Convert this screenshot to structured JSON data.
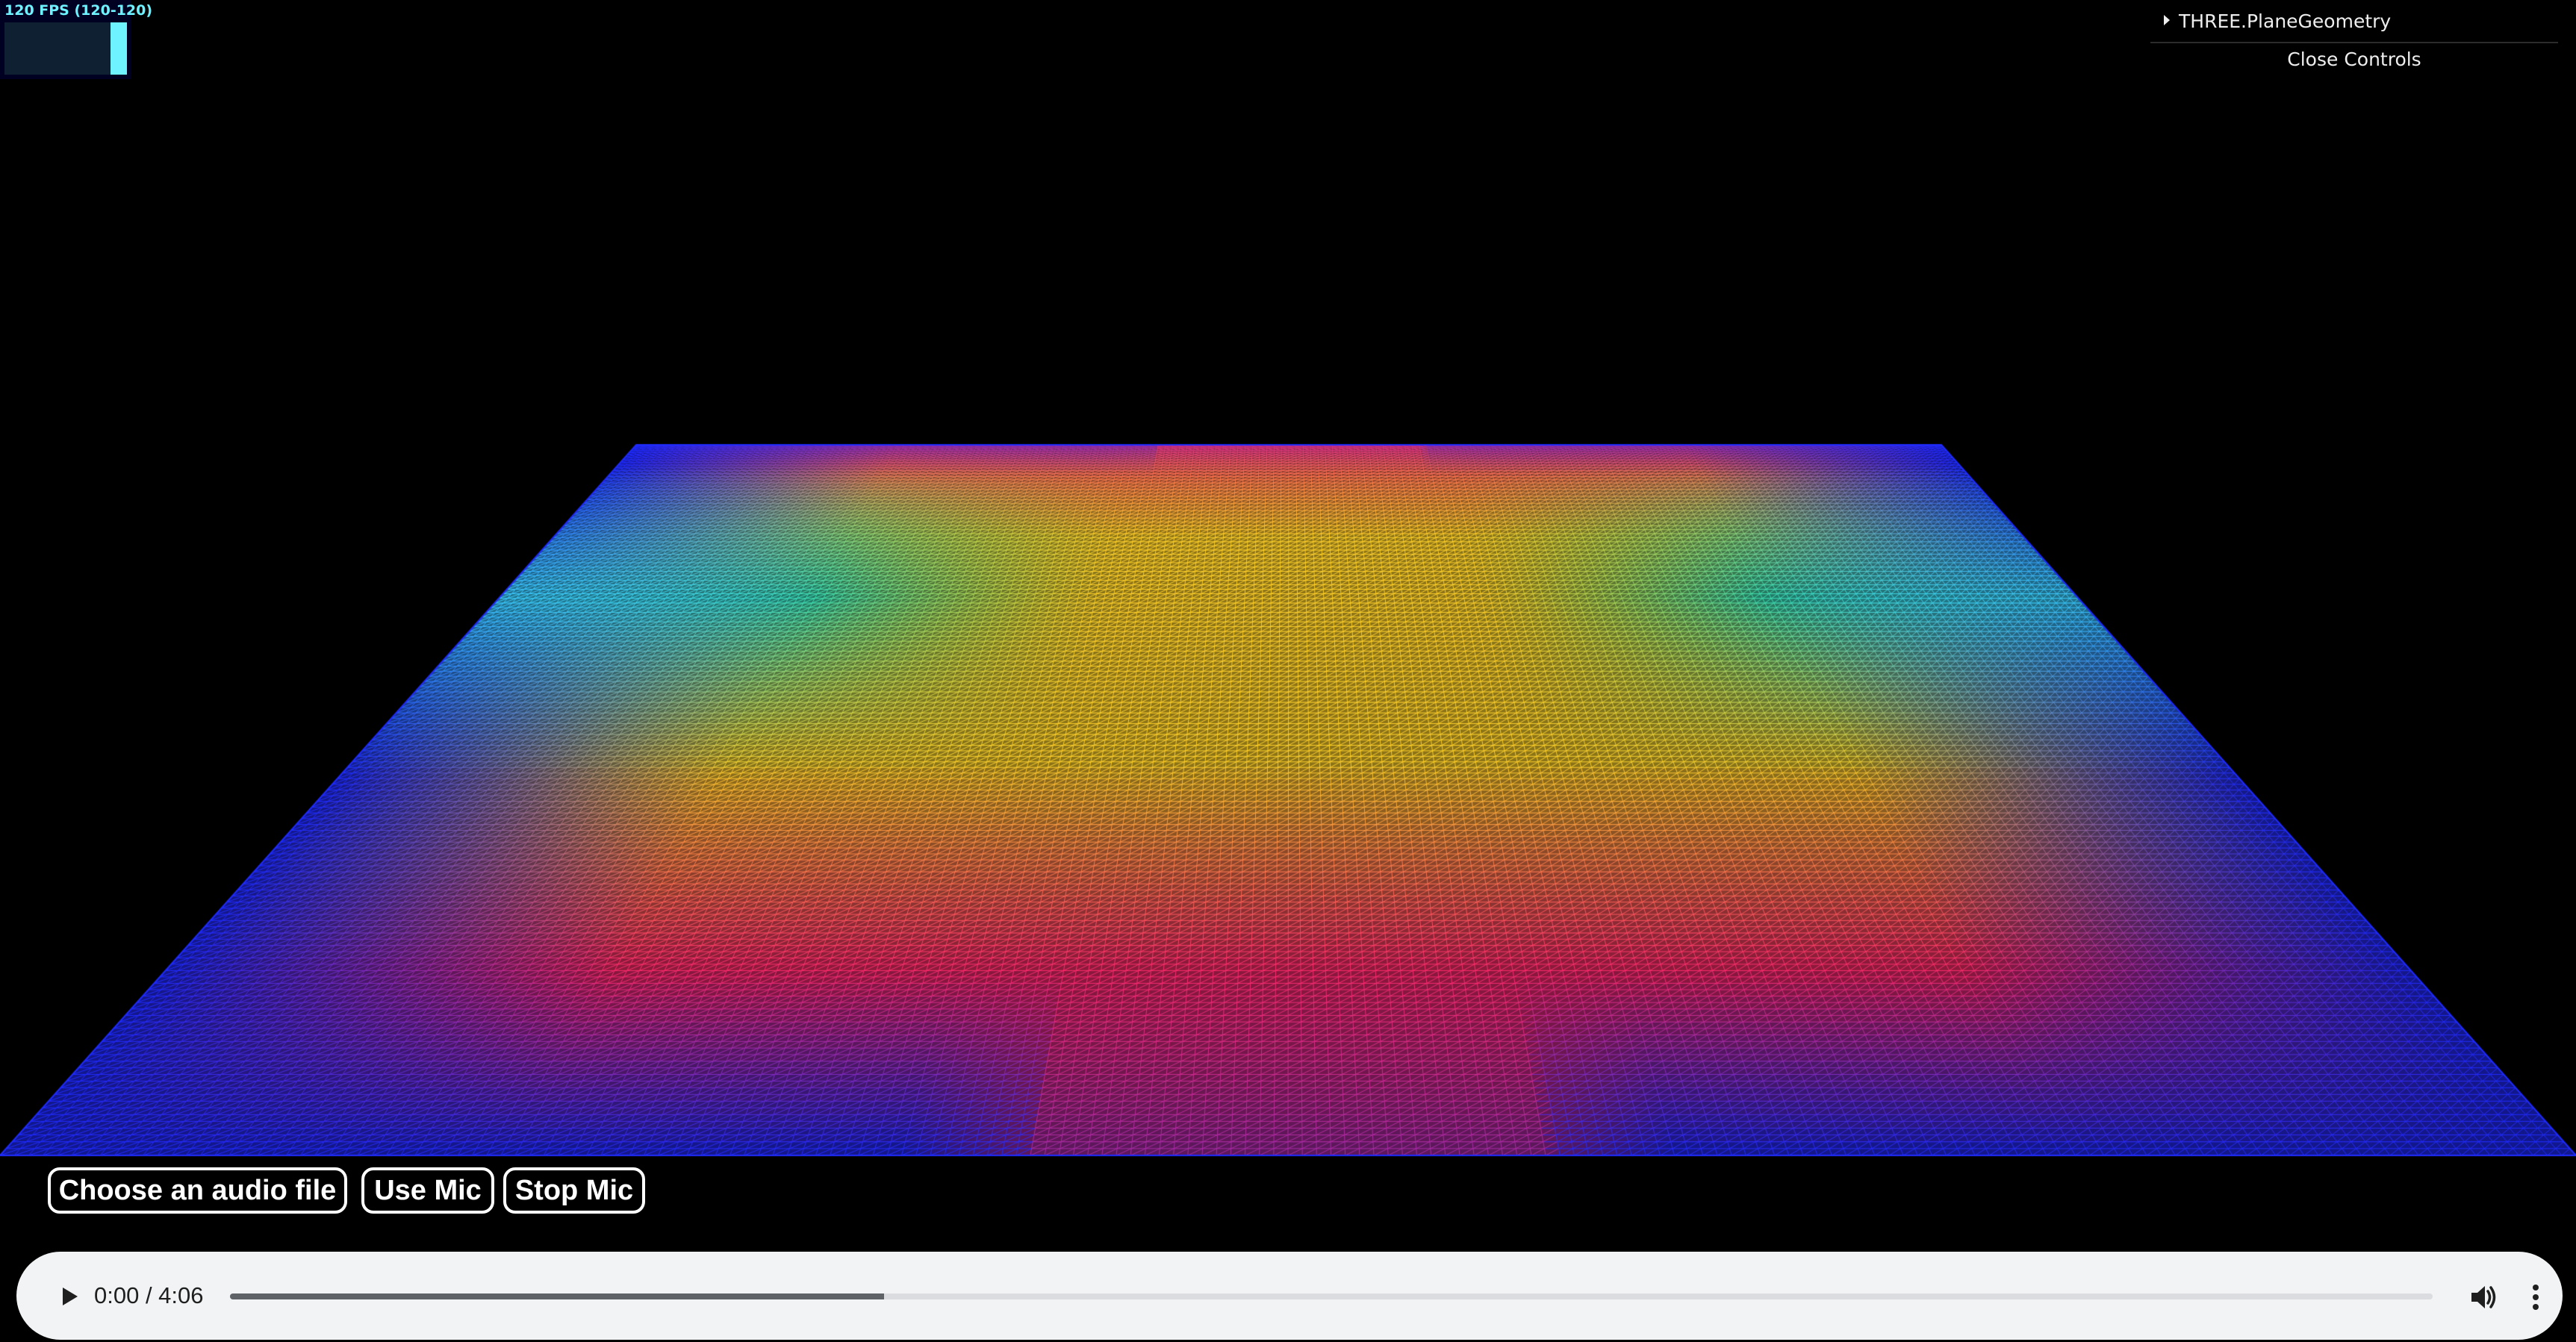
{
  "stats": {
    "label": "120 FPS (120-120)",
    "level_fraction": 1.0,
    "color": "#6ff2ff",
    "background": "#000022"
  },
  "gui": {
    "folder_title": "THREE.PlaneGeometry",
    "folder_icon": "triangle-right-icon",
    "close_label": "Close Controls"
  },
  "scene": {
    "background": "#000000",
    "mesh_type": "wireframe-plane",
    "palette": {
      "edge": "#1f2bff",
      "center_far": "#ff2b6e",
      "center_mid": "#ffd12b",
      "green": "#39e04a",
      "cyan": "#3fe0ff",
      "center_near": "#ff2b6e"
    }
  },
  "audio_buttons": [
    {
      "label": "Choose an audio file"
    },
    {
      "label": "Use Mic"
    },
    {
      "label": "Stop Mic"
    }
  ],
  "player": {
    "time_text": "0:00 / 4:06",
    "progress_fraction": 0.297,
    "play_icon": "play-icon",
    "volume_icon": "volume-icon",
    "more_icon": "more-vert-icon"
  }
}
